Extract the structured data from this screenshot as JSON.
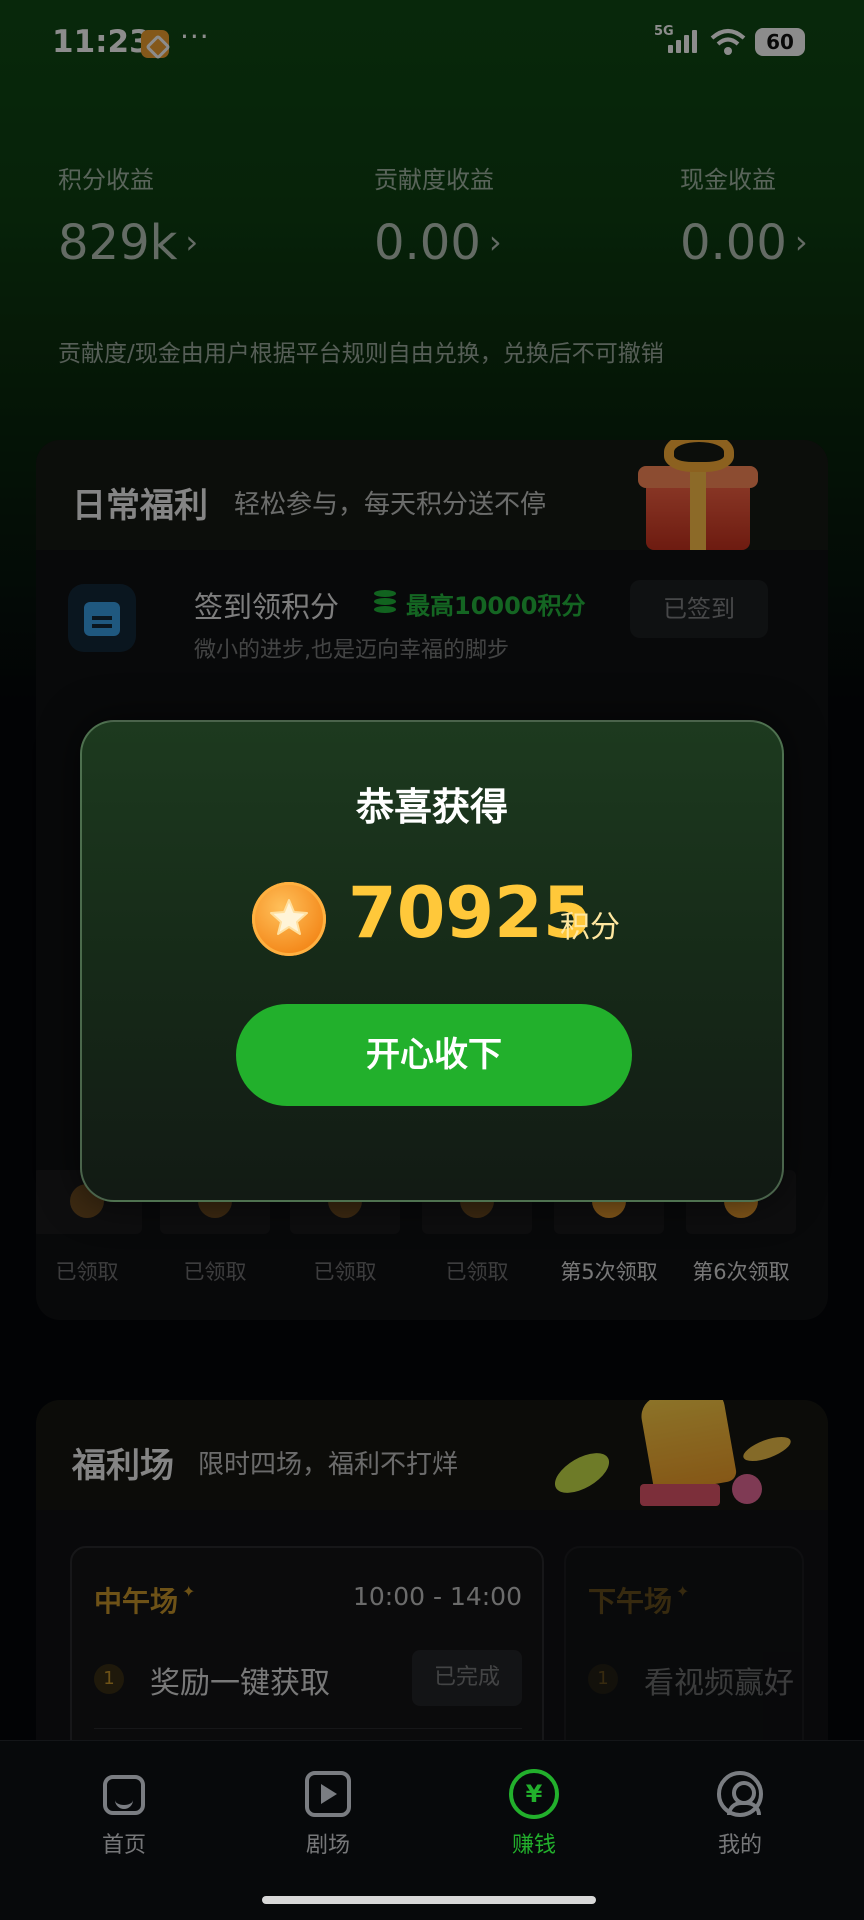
{
  "status_bar": {
    "time": "11:23",
    "more": "···",
    "network": "5G",
    "battery": "60"
  },
  "earnings": [
    {
      "label": "积分收益",
      "value": "829k",
      "chevron": "›"
    },
    {
      "label": "贡献度收益",
      "value": "0.00",
      "chevron": "›"
    },
    {
      "label": "现金收益",
      "value": "0.00",
      "chevron": "›"
    }
  ],
  "earnings_note": "贡献度/现金由用户根据平台规则自由兑换，兑换后不可撤销",
  "daily": {
    "title": "日常福利",
    "subtitle": "轻松参与，每天积分送不停",
    "checkin": {
      "title": "签到领积分",
      "max_label": "最高10000积分",
      "desc": "微小的进步,也是迈向幸福的脚步",
      "button": "已签到"
    },
    "rewards": [
      {
        "label": "已领取"
      },
      {
        "label": "已领取"
      },
      {
        "label": "已领取"
      },
      {
        "label": "已领取"
      },
      {
        "label": "第5次领取"
      },
      {
        "label": "第6次领取"
      }
    ]
  },
  "welfare": {
    "title": "福利场",
    "subtitle": "限时四场，福利不打烊",
    "sessions": [
      {
        "name": "中午场",
        "time": "10:00 - 14:00",
        "task_num": "1",
        "task": "奖励一键获取",
        "task_status": "已完成"
      },
      {
        "name": "下午场",
        "task_num": "1",
        "task": "看视频赢好"
      }
    ]
  },
  "modal": {
    "title": "恭喜获得",
    "amount": "70925",
    "unit": "积分",
    "accept_button": "开心收下"
  },
  "nav": [
    {
      "label": "首页",
      "icon": "home-icon"
    },
    {
      "label": "剧场",
      "icon": "theater-icon"
    },
    {
      "label": "赚钱",
      "icon": "yen-icon",
      "glyph": "¥",
      "active": true
    },
    {
      "label": "我的",
      "icon": "profile-icon"
    }
  ],
  "colors": {
    "accent_green": "#22b02c",
    "gold": "#ffc83a",
    "session_gold": "#c9962a"
  }
}
